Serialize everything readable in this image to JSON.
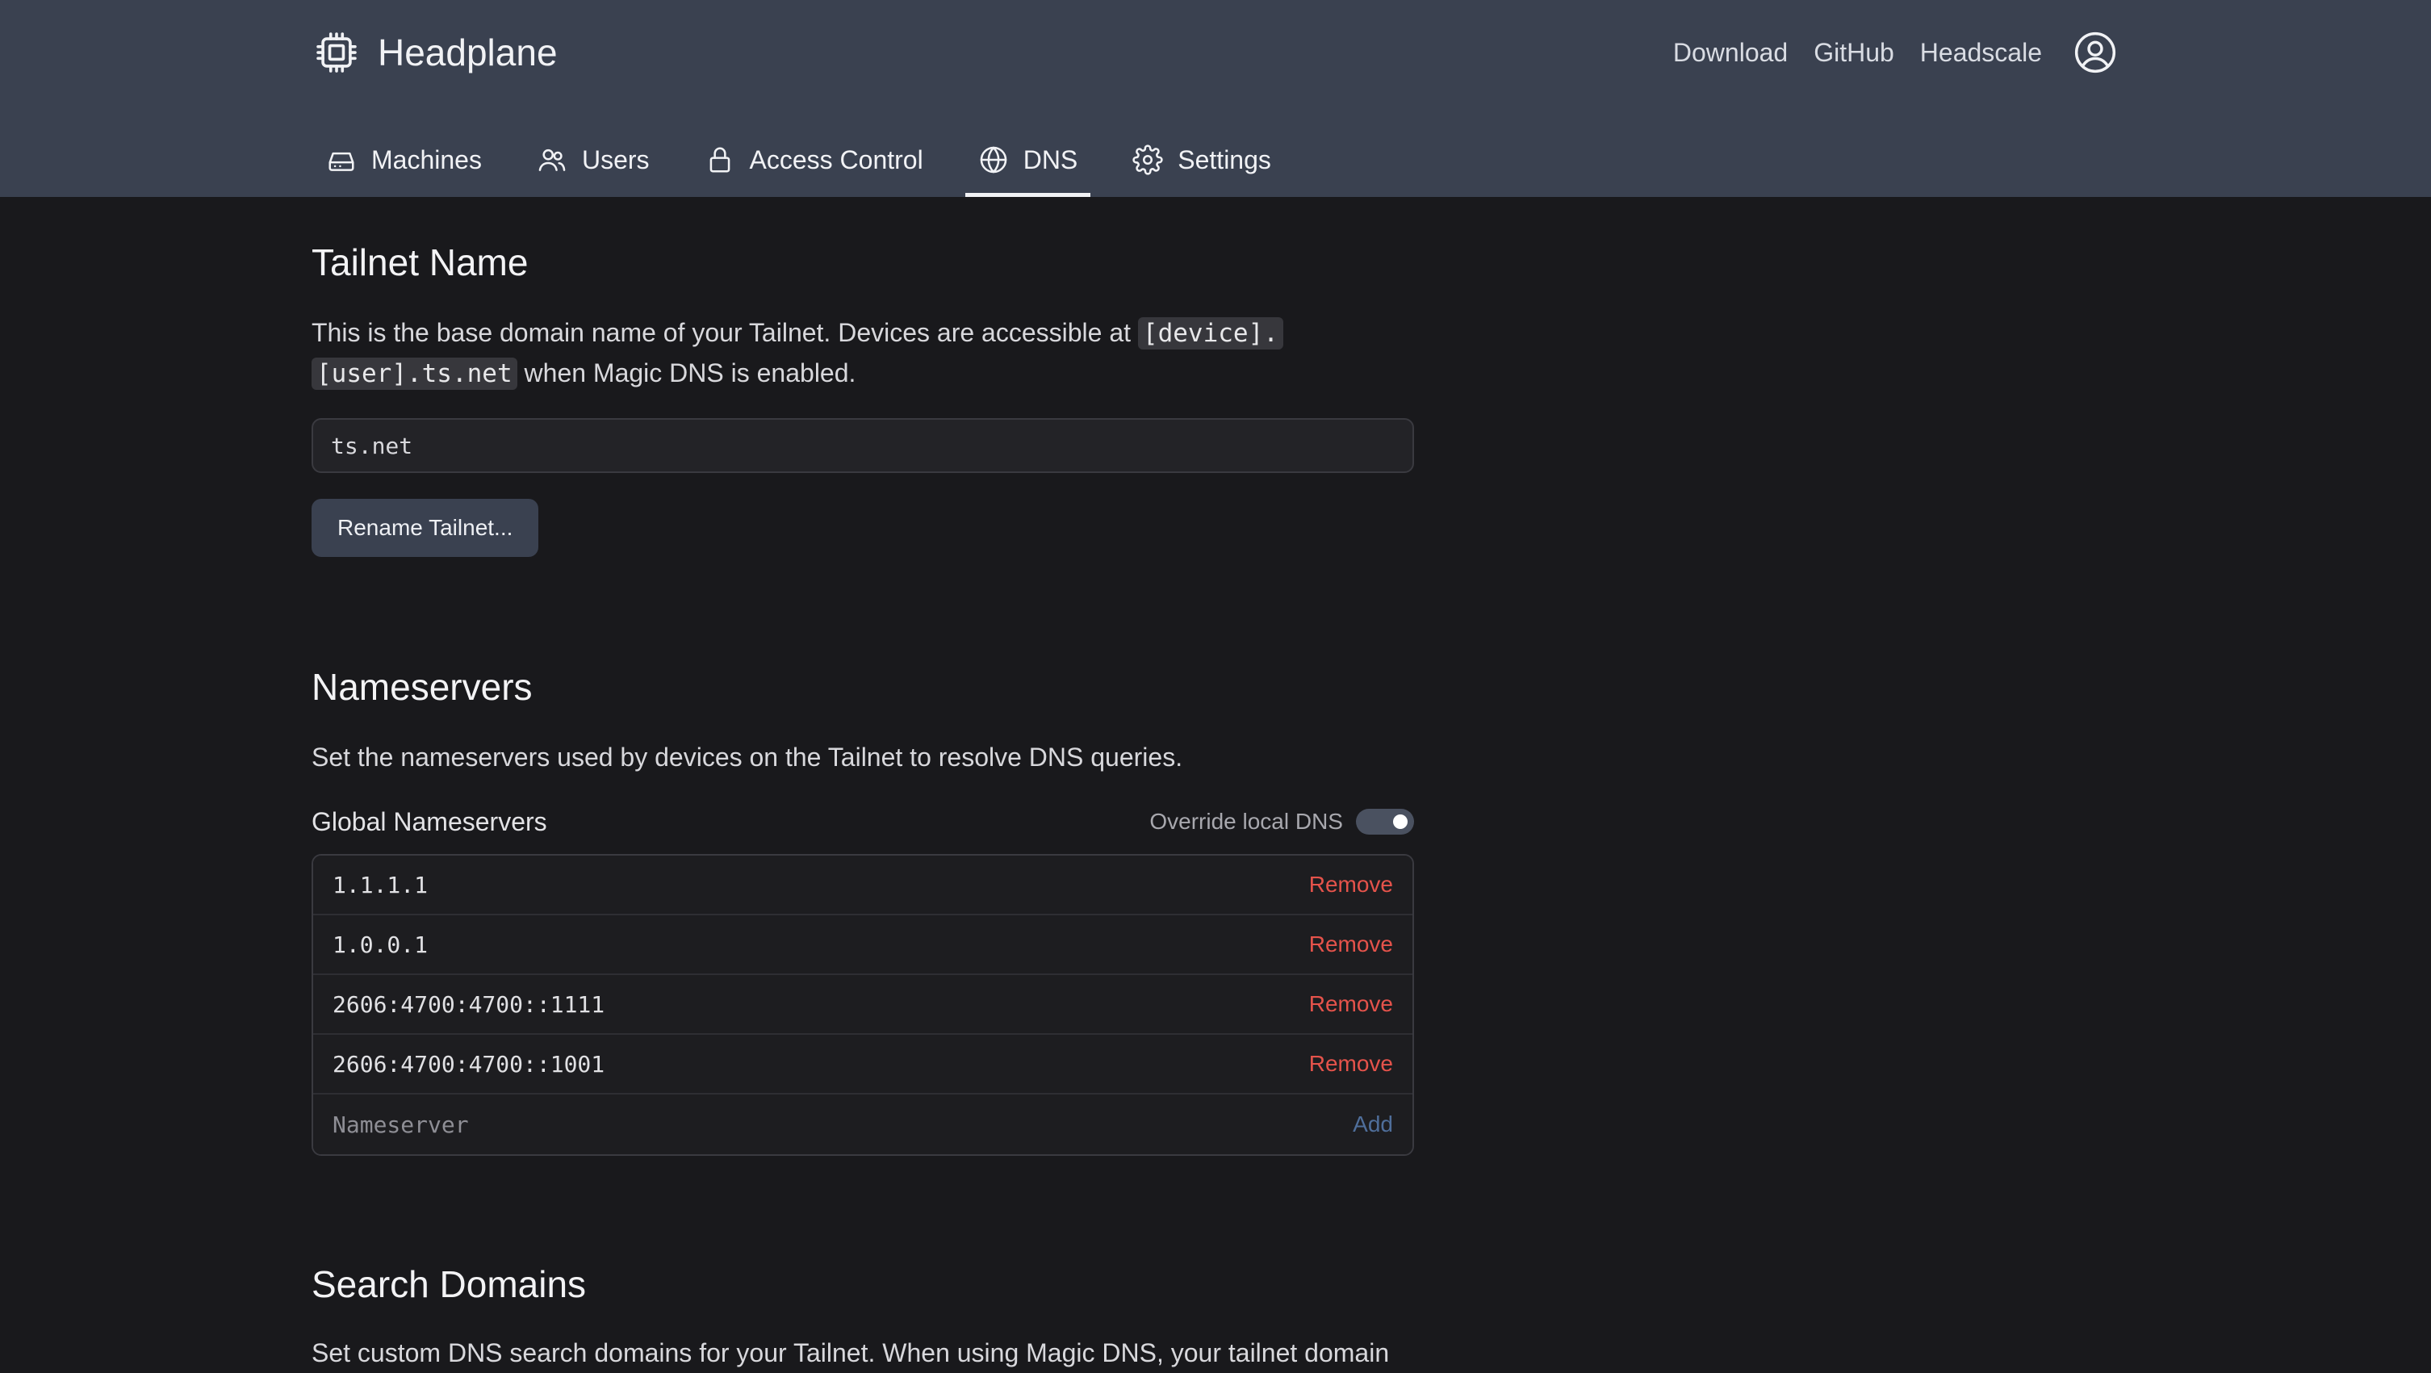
{
  "header": {
    "app_name": "Headplane",
    "logo_icon": "chip-icon",
    "links": [
      "Download",
      "GitHub",
      "Headscale"
    ],
    "account_icon": "user-circle-icon"
  },
  "nav": {
    "tabs": [
      {
        "label": "Machines",
        "icon": "server-icon"
      },
      {
        "label": "Users",
        "icon": "users-icon"
      },
      {
        "label": "Access Control",
        "icon": "lock-icon"
      },
      {
        "label": "DNS",
        "icon": "globe-icon",
        "active": true
      },
      {
        "label": "Settings",
        "icon": "gear-icon"
      }
    ]
  },
  "tailnet": {
    "title": "Tailnet Name",
    "desc_prefix": "This is the base domain name of your Tailnet. Devices are accessible at ",
    "desc_code_1": "[device].",
    "desc_code_2": "[user].ts.net",
    "desc_suffix": " when Magic DNS is enabled.",
    "value": "ts.net",
    "rename_label": "Rename Tailnet..."
  },
  "nameservers": {
    "title": "Nameservers",
    "desc": "Set the nameservers used by devices on the Tailnet to resolve DNS queries.",
    "global_label": "Global Nameservers",
    "override_label": "Override local DNS",
    "override_enabled": true,
    "items": [
      "1.1.1.1",
      "1.0.0.1",
      "2606:4700:4700::1111",
      "2606:4700:4700::1001"
    ],
    "remove_label": "Remove",
    "input_placeholder": "Nameserver",
    "add_label": "Add"
  },
  "search_domains": {
    "title": "Search Domains",
    "desc": "Set custom DNS search domains for your Tailnet. When using Magic DNS, your tailnet domain"
  },
  "colors": {
    "header_bg": "#3a4150",
    "page_bg": "#19191c",
    "remove": "#e5534b",
    "add": "#4f6e9a"
  }
}
